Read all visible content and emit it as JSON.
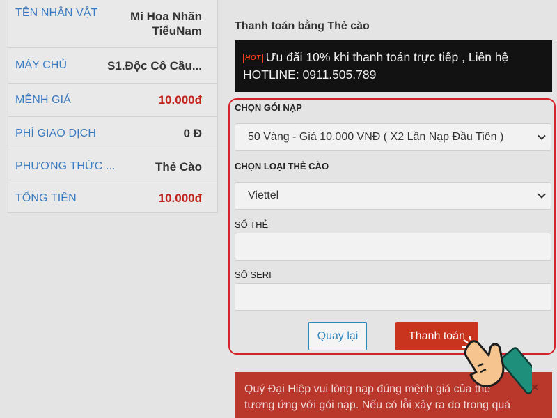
{
  "summary": [
    {
      "label": "TÊN NHÂN VẬT",
      "value_line1": "Mi Hoa Nhãn",
      "value_line2": "TiểuNam",
      "highlight": false
    },
    {
      "label": "MÁY CHỦ",
      "value_line1": "S1.Độc Cô Cầu...",
      "highlight": false
    },
    {
      "label": "MỆNH GIÁ",
      "value_line1": "10.000đ",
      "highlight": true
    },
    {
      "label": "PHÍ GIAO DỊCH",
      "value_line1": "0 Đ",
      "highlight": false
    },
    {
      "label": "PHƯƠNG THỨC ...",
      "value_line1": "Thẻ Cào",
      "highlight": false
    },
    {
      "label": "TỔNG TIỀN",
      "value_line1": "10.000đ",
      "highlight": true
    }
  ],
  "payment": {
    "title": "Thanh toán bằng Thẻ cào",
    "promo_badge": "HOT",
    "promo_line1": "Ưu đãi 10% khi thanh toán trực tiếp , Liên hệ",
    "promo_line2": "HOTLINE: 0911.505.789"
  },
  "form": {
    "package_label": "CHỌN GÓI NẠP",
    "package_value": "50 Vàng - Giá 10.000 VNĐ ( X2 Lần Nạp Đầu Tiên )",
    "card_type_label": "CHỌN LOẠI THẺ CÀO",
    "card_type_value": "Viettel",
    "card_number_label": "SỐ THẺ",
    "card_number_value": "",
    "serial_label": "SỐ SERI",
    "serial_value": "",
    "back_label": "Quay lại",
    "pay_label": "Thanh toán"
  },
  "alert": {
    "line1": "Quý Đại Hiệp vui lòng nạp đúng mệnh giá của thẻ",
    "line2": "tương ứng với gói nạp. Nếu có lỗi xảy ra do trong quá",
    "close": "×"
  },
  "colors": {
    "accent_red": "#c2231b",
    "label_blue": "#3a7ac0",
    "form_border": "#d6232b"
  },
  "icons": [
    "hot-badge-icon",
    "chevron-down-icon",
    "close-icon",
    "pointing-hand-icon"
  ]
}
